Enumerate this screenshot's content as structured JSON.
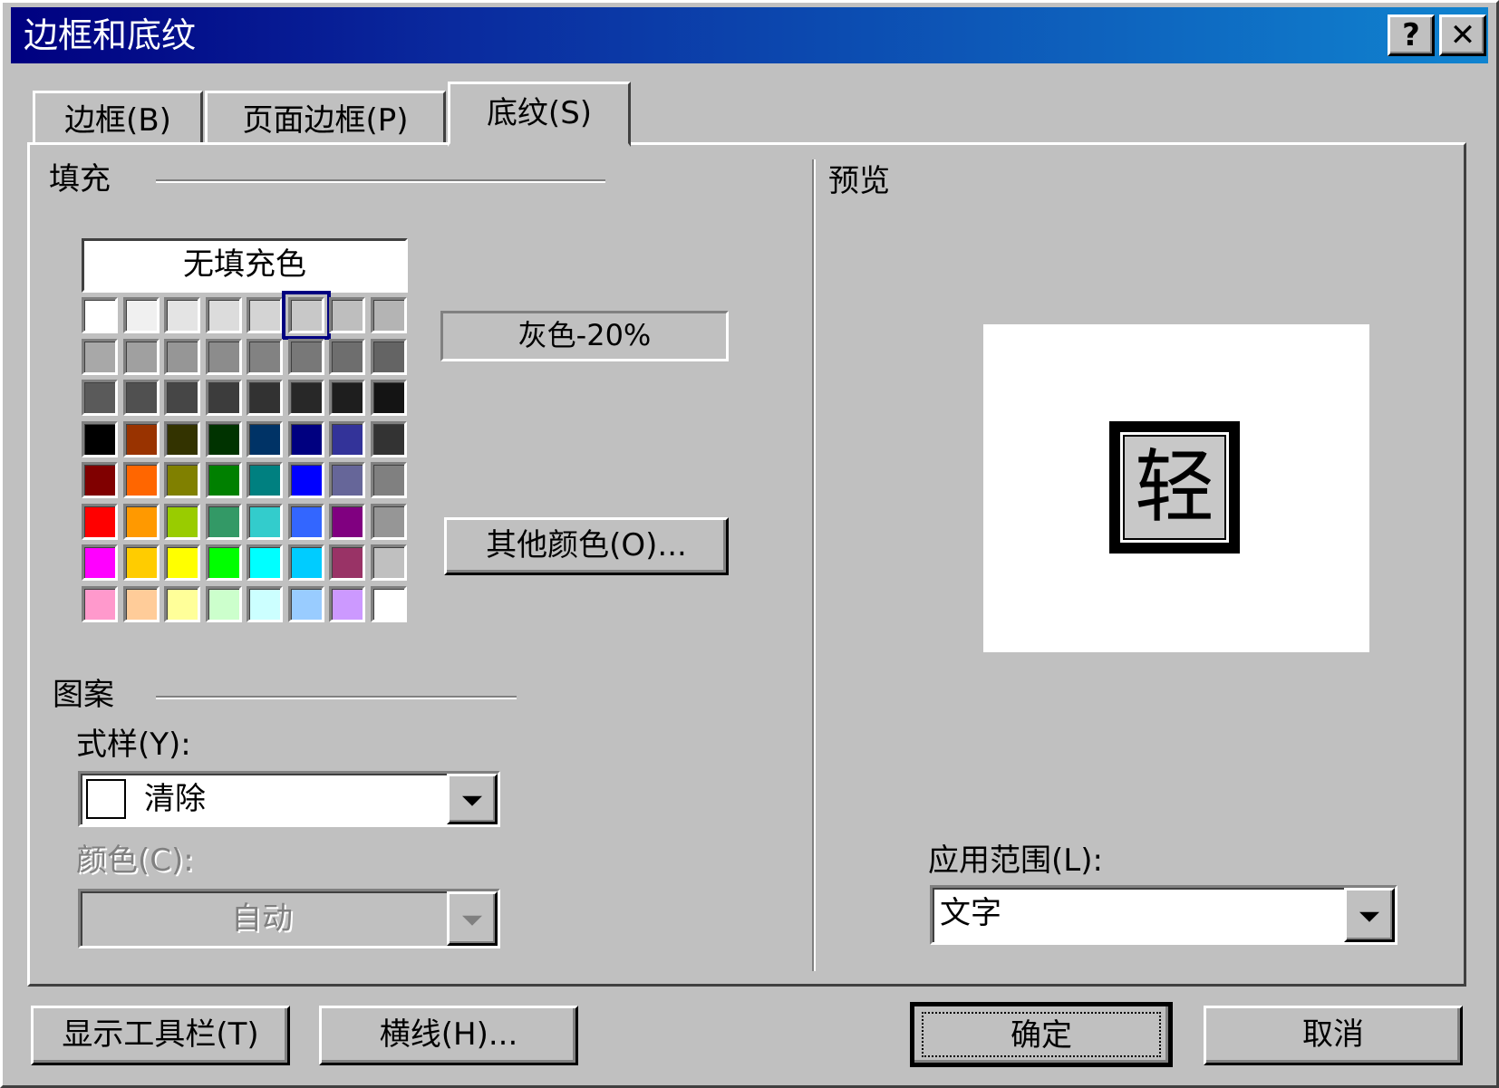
{
  "window": {
    "title": "边框和底纹",
    "help_label": "?",
    "close_label": "✕"
  },
  "tabs": [
    {
      "label": "边框(B)",
      "active": false
    },
    {
      "label": "页面边框(P)",
      "active": false
    },
    {
      "label": "底纹(S)",
      "active": true
    }
  ],
  "fill": {
    "section_label": "填充",
    "no_fill_label": "无填充色",
    "selected_color_name": "灰色-20%",
    "more_colors_label": "其他颜色(O)...",
    "palette": [
      [
        "#ffffff",
        "#f0f0f0",
        "#e4e4e4",
        "#dcdcdc",
        "#d4d4d4",
        "#c8c8c8",
        "#bebebe",
        "#b4b4b4"
      ],
      [
        "#a8a8a8",
        "#a0a0a0",
        "#969696",
        "#8c8c8c",
        "#828282",
        "#787878",
        "#6e6e6e",
        "#646464"
      ],
      [
        "#5a5a5a",
        "#505050",
        "#464646",
        "#3c3c3c",
        "#323232",
        "#282828",
        "#1e1e1e",
        "#141414"
      ],
      [
        "#000000",
        "#993300",
        "#333300",
        "#003300",
        "#003366",
        "#000080",
        "#333399",
        "#333333"
      ],
      [
        "#800000",
        "#ff6600",
        "#808000",
        "#008000",
        "#008080",
        "#0000ff",
        "#666699",
        "#808080"
      ],
      [
        "#ff0000",
        "#ff9900",
        "#99cc00",
        "#339966",
        "#33cccc",
        "#3366ff",
        "#800080",
        "#969696"
      ],
      [
        "#ff00ff",
        "#ffcc00",
        "#ffff00",
        "#00ff00",
        "#00ffff",
        "#00ccff",
        "#993366",
        "#c0c0c0"
      ],
      [
        "#ff99cc",
        "#ffcc99",
        "#ffff99",
        "#ccffcc",
        "#ccffff",
        "#99ccff",
        "#cc99ff",
        "#ffffff"
      ]
    ],
    "selected_index": [
      0,
      5
    ]
  },
  "pattern": {
    "section_label": "图案",
    "style_label": "式样(Y):",
    "style_value": "清除",
    "color_label": "颜色(C):",
    "color_value": "自动"
  },
  "preview": {
    "section_label": "预览",
    "sample_char": "轻",
    "apply_label": "应用范围(L):",
    "apply_value": "文字"
  },
  "buttons": {
    "show_toolbar": "显示工具栏(T)",
    "horizontal_line": "横线(H)...",
    "ok": "确定",
    "cancel": "取消"
  }
}
